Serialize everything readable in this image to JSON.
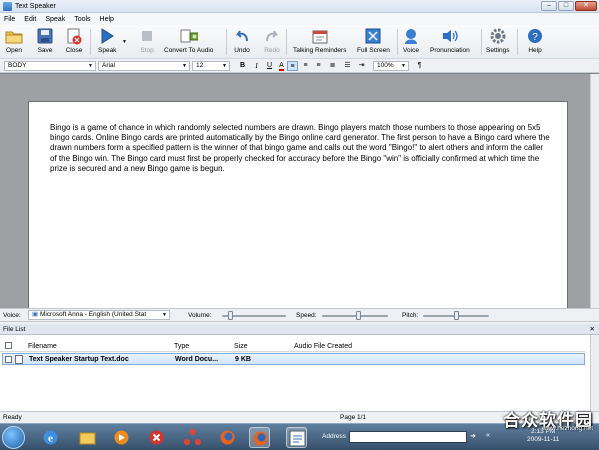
{
  "window": {
    "title": "Text Speaker"
  },
  "menu": [
    "File",
    "Edit",
    "Speak",
    "Tools",
    "Help"
  ],
  "toolbar": {
    "open": "Open",
    "save": "Save",
    "close": "Close",
    "speak": "Speak",
    "stop": "Stop",
    "convert": "Convert To Audio",
    "undo": "Undo",
    "redo": "Redo",
    "talking_reminders": "Talking Reminders",
    "full_screen": "Full Screen",
    "voice": "Voice",
    "pronunciation": "Pronunciation",
    "settings": "Settings",
    "help": "Help"
  },
  "format": {
    "style": "BODY",
    "font": "Arial",
    "size": "12",
    "zoom": "100%"
  },
  "document": {
    "text": "Bingo is a game of chance in which randomly selected numbers are drawn. Bingo players match those numbers to those appearing on 5x5 bingo cards. Online Bingo cards are printed automatically by the Bingo online card generator. The first person to have a Bingo card where the drawn numbers form a specified pattern is the winner of that bingo game and calls out the word \"Bingo!\" to alert others and inform the caller of the Bingo win. The Bingo card must first be properly checked for accuracy before the Bingo \"win\" is officially confirmed at which time the prize is secured and a new Bingo game is begun."
  },
  "voicebar": {
    "voice_label": "Voice:",
    "voice_value": "Microsoft Anna - English (United Stat",
    "volume_label": "Volume:",
    "speed_label": "Speed:",
    "pitch_label": "Pitch:",
    "volume_level": 0.1,
    "speed_level": 0.55,
    "pitch_level": 0.5
  },
  "filelist": {
    "title": "File List",
    "columns": [
      "Filename",
      "Type",
      "Size",
      "Audio File Created"
    ],
    "rows": [
      {
        "filename": "Text Speaker Startup Text.doc",
        "type": "Word Docu...",
        "size": "9 KB",
        "audio": ""
      }
    ]
  },
  "status": {
    "left": "Ready",
    "page": "Page 1/1"
  },
  "taskbar": {
    "address_label": "Address",
    "time": "2:13 PM",
    "date": "2009-11-11"
  },
  "watermark": {
    "cn": "合众软件园",
    "url": "www.hezhong.net"
  },
  "colors": {
    "accent": "#2f6fbf",
    "selection": "#cfe4fa"
  }
}
